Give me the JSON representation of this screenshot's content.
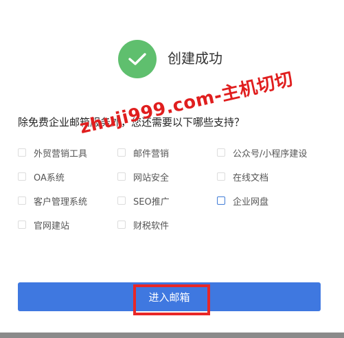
{
  "success": {
    "icon": "check-icon",
    "title": "创建成功",
    "color": "#5fbf6e"
  },
  "question": "除免费企业邮箱服务外，您还需要以下哪些支持？",
  "options": [
    {
      "label": "外贸营销工具",
      "checked": false
    },
    {
      "label": "邮件营销",
      "checked": false
    },
    {
      "label": "公众号/小程序建设",
      "checked": false
    },
    {
      "label": "OA系统",
      "checked": false
    },
    {
      "label": "网站安全",
      "checked": false
    },
    {
      "label": "在线文档",
      "checked": false
    },
    {
      "label": "客户管理系统",
      "checked": false
    },
    {
      "label": "SEO推广",
      "checked": false
    },
    {
      "label": "企业网盘",
      "checked": false
    },
    {
      "label": "官网建站",
      "checked": false
    },
    {
      "label": "财税软件",
      "checked": false
    }
  ],
  "watermark": "zhuji999.com-主机切切",
  "enter_button": {
    "label": "进入邮箱",
    "color": "#3f78e0"
  },
  "highlight_color": "#e82727"
}
